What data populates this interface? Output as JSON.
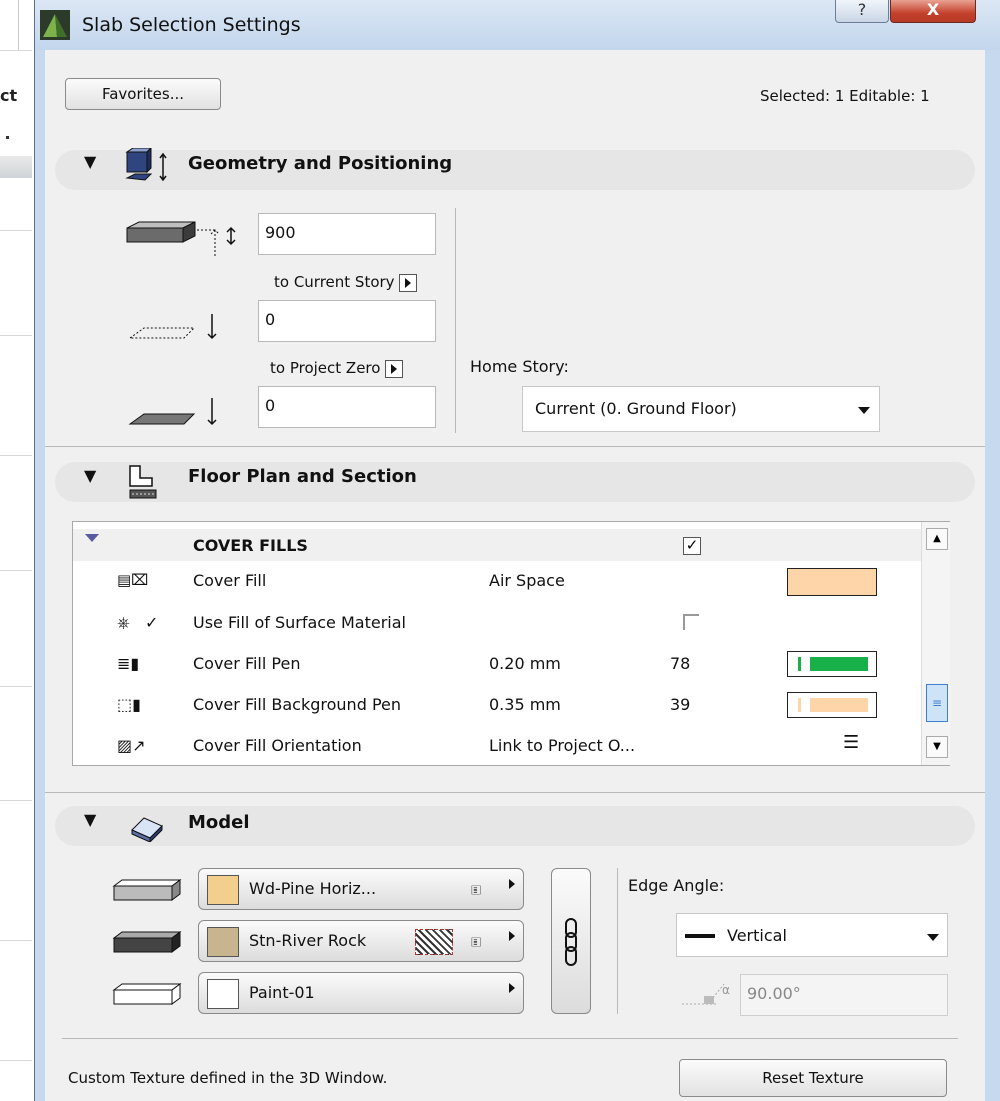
{
  "window": {
    "title": "Slab Selection Settings",
    "help_glyph": "?",
    "close_glyph": "X"
  },
  "background": {
    "fragment": "ct"
  },
  "header": {
    "favorites_label": "Favorites...",
    "selection_status": "Selected: 1 Editable: 1"
  },
  "geometry": {
    "title": "Geometry and Positioning",
    "thickness_value": "900",
    "ref1_label": "to Current Story",
    "offset1_value": "0",
    "ref2_label": "to Project Zero",
    "offset2_value": "0",
    "home_story_label": "Home Story:",
    "home_story_value": "Current (0. Ground Floor)"
  },
  "floor_plan": {
    "title": "Floor Plan and Section",
    "group_label": "COVER FILLS",
    "group_checked": true,
    "rows": [
      {
        "label": "Cover Fill",
        "value": "Air Space",
        "pen": "",
        "swatch_color": "#fdd5a8"
      },
      {
        "label": "Use Fill of Surface Material",
        "value": "",
        "pen": "",
        "checkbox": false
      },
      {
        "label": "Cover Fill Pen",
        "value": "0.20 mm",
        "pen": "78",
        "pen_color": "#19b049"
      },
      {
        "label": "Cover Fill Background Pen",
        "value": "0.35 mm",
        "pen": "39",
        "pen_color": "#fdd5a8"
      },
      {
        "label": "Cover Fill Orientation",
        "value": "Link to Project O...",
        "pen": ""
      }
    ]
  },
  "model": {
    "title": "Model",
    "materials": [
      {
        "name": "Wd-Pine Horiz...",
        "color": "#f3cf8e"
      },
      {
        "name": "Stn-River Rock",
        "color": "#c8b590"
      },
      {
        "name": "Paint-01",
        "color": "#ffffff"
      }
    ],
    "edge_angle_label": "Edge Angle:",
    "edge_angle_value": "Vertical",
    "angle_value": "90.00°",
    "alpha_symbol": "α"
  },
  "footer": {
    "note": "Custom Texture defined in the 3D Window.",
    "reset_label": "Reset Texture"
  },
  "colors": {
    "title_bar": "#c7d9ee",
    "close_red": "#c4412c",
    "section_bar": "#e6e6e6",
    "scroll_accent": "#3e7fd0"
  },
  "icons": [
    "app-logo-icon",
    "help-icon",
    "close-icon",
    "geometry-icon",
    "floorplan-icon",
    "model-icon",
    "chain-link-icon"
  ]
}
